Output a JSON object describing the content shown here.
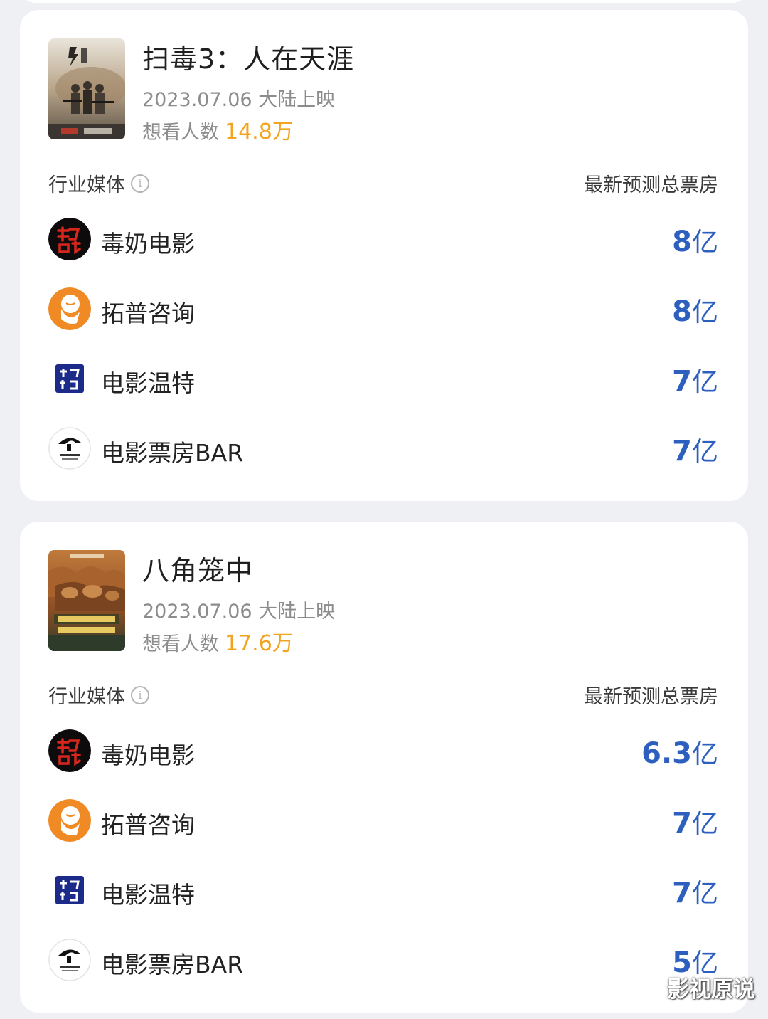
{
  "colors": {
    "page_background": "#eef0f3",
    "card_background": "#ffffff",
    "accent_orange": "#f3a41f",
    "prediction_blue": "#2d5fbe"
  },
  "movies": [
    {
      "title": "扫毒3：人在天涯",
      "release": "2023.07.06 大陆上映",
      "want_label": "想看人数",
      "want_value": "14.8万",
      "header_left": "行业媒体",
      "header_right": "最新预测总票房",
      "predictions": [
        {
          "media": "毒奶电影",
          "num": "8",
          "unit": "亿",
          "icon": "dunai-logo"
        },
        {
          "media": "拓普咨询",
          "num": "8",
          "unit": "亿",
          "icon": "tuopu-logo"
        },
        {
          "media": "电影温特",
          "num": "7",
          "unit": "亿",
          "icon": "wente-logo"
        },
        {
          "media": "电影票房BAR",
          "num": "7",
          "unit": "亿",
          "icon": "bar-logo"
        }
      ]
    },
    {
      "title": "八角笼中",
      "release": "2023.07.06 大陆上映",
      "want_label": "想看人数",
      "want_value": "17.6万",
      "header_left": "行业媒体",
      "header_right": "最新预测总票房",
      "predictions": [
        {
          "media": "毒奶电影",
          "num": "6.3",
          "unit": "亿",
          "icon": "dunai-logo"
        },
        {
          "media": "拓普咨询",
          "num": "7",
          "unit": "亿",
          "icon": "tuopu-logo"
        },
        {
          "media": "电影温特",
          "num": "7",
          "unit": "亿",
          "icon": "wente-logo"
        },
        {
          "media": "电影票房BAR",
          "num": "5",
          "unit": "亿",
          "icon": "bar-logo"
        }
      ]
    }
  ],
  "watermark": "影视原说"
}
